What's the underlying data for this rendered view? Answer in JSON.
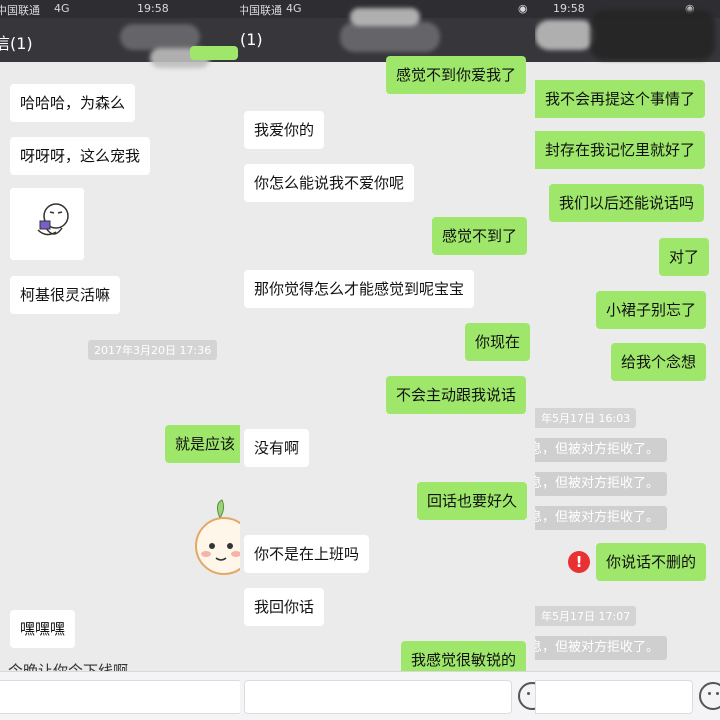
{
  "panel1": {
    "status": {
      "carrier": "中国联通",
      "network": "4G",
      "time": "19:58"
    },
    "title": "信(1)",
    "messages": [
      "哈哈哈，为森么",
      "呀呀呀，这么宠我",
      "柯基很灵活嘛",
      "嘿嘿嘿",
      "就是应该"
    ],
    "timestamp": "2017年3月20日 17:36",
    "cut_text": "今晚让你今下线啊"
  },
  "panel2": {
    "status": {
      "carrier": "中国联通",
      "network": "4G"
    },
    "title": "(1)",
    "messages": [
      "感觉不到你爱我了",
      "我爱你的",
      "你怎么能说我不爱你呢",
      "感觉不到了",
      "那你觉得怎么才能感觉到呢宝宝",
      "你现在",
      "不会主动跟我说话",
      "没有啊",
      "回话也要好久",
      "你不是在上班吗",
      "我回你话",
      "我感觉很敏锐的"
    ]
  },
  "panel3": {
    "status": {
      "time": "19:58"
    },
    "messages": [
      "我不会再提这个事情了",
      "封存在我记忆里就好了",
      "我们以后还能说话吗",
      "对了",
      "小裙子别忘了",
      "给我个念想",
      "你说话不删的"
    ],
    "timestamps": [
      "年5月17日 16:03",
      "年5月17日 17:07"
    ],
    "rejected": [
      "息，但被对方拒收了。",
      "息，但被对方拒收了。",
      "息，但被对方拒收了。",
      "息，但被对方拒收了。"
    ],
    "error_mark": "!"
  },
  "colors": {
    "outgoing": "#9ee76a",
    "incoming": "#ffffff",
    "background": "#ebebeb",
    "header": "#37373b",
    "error": "#e83131"
  },
  "icons": {
    "emoji": "emoji-icon",
    "error": "error-icon",
    "sticker": "cartoon-sticker"
  }
}
